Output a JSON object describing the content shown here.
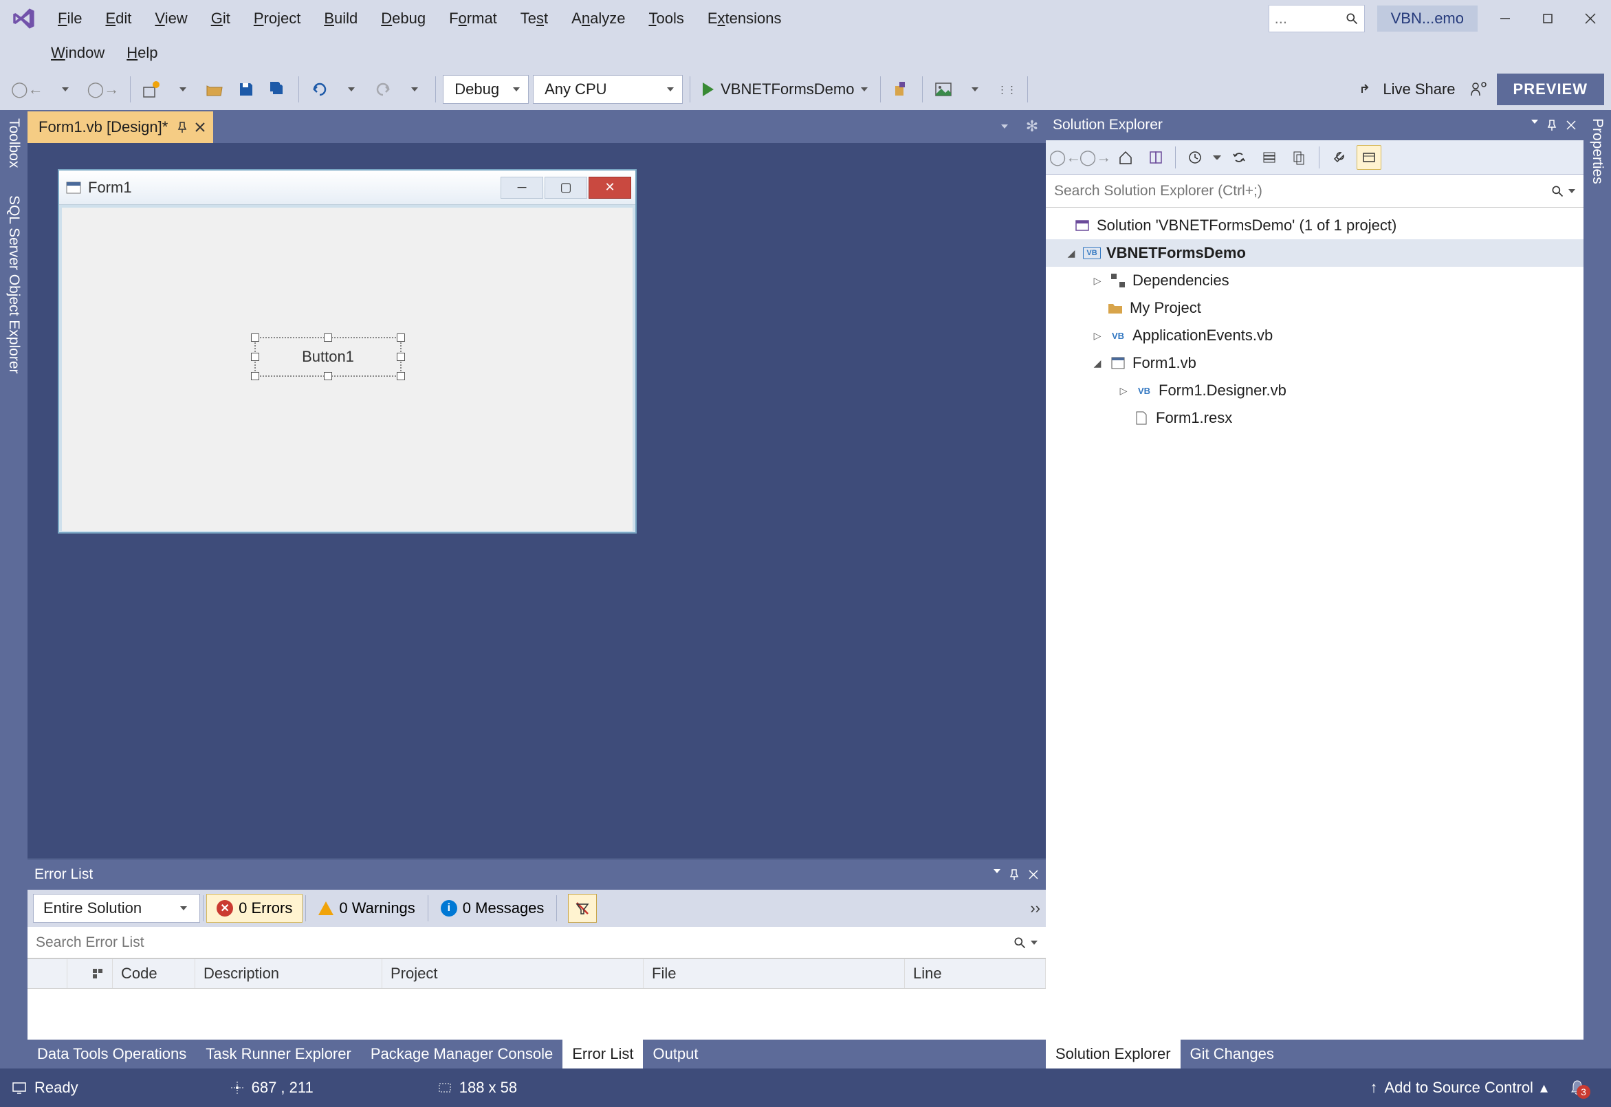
{
  "titlebar": {
    "menus": [
      "File",
      "Edit",
      "View",
      "Git",
      "Project",
      "Build",
      "Debug",
      "Format",
      "Test",
      "Analyze",
      "Tools",
      "Extensions"
    ],
    "menus2": [
      "Window",
      "Help"
    ],
    "search_placeholder": "...",
    "doc_selector": "VBN...emo"
  },
  "toolbar": {
    "config": "Debug",
    "platform": "Any CPU",
    "run_target": "VBNETFormsDemo",
    "live_share": "Live Share",
    "preview": "PREVIEW"
  },
  "doc_tab": {
    "title": "Form1.vb [Design]*"
  },
  "form": {
    "title": "Form1",
    "button_text": "Button1"
  },
  "left_rail": [
    "Toolbox",
    "SQL Server Object Explorer"
  ],
  "right_rail": [
    "Properties"
  ],
  "solution_explorer": {
    "title": "Solution Explorer",
    "search_placeholder": "Search Solution Explorer (Ctrl+;)",
    "solution_text": "Solution 'VBNETFormsDemo' (1 of 1 project)",
    "project": "VBNETFormsDemo",
    "items": {
      "dependencies": "Dependencies",
      "my_project": "My Project",
      "app_events": "ApplicationEvents.vb",
      "form1": "Form1.vb",
      "form1_designer": "Form1.Designer.vb",
      "form1_resx": "Form1.resx"
    }
  },
  "error_list": {
    "title": "Error List",
    "scope": "Entire Solution",
    "errors": "0 Errors",
    "warnings": "0 Warnings",
    "messages": "0 Messages",
    "search_placeholder": "Search Error List",
    "columns": [
      "Code",
      "Description",
      "Project",
      "File",
      "Line"
    ]
  },
  "bottom_tabs": {
    "left": [
      "Data Tools Operations",
      "Task Runner Explorer",
      "Package Manager Console",
      "Error List",
      "Output"
    ],
    "left_active": "Error List",
    "right": [
      "Solution Explorer",
      "Git Changes"
    ],
    "right_active": "Solution Explorer"
  },
  "statusbar": {
    "ready": "Ready",
    "pos": "687 , 211",
    "size": "188 x 58",
    "source_control": "Add to Source Control",
    "notifications": "3"
  }
}
